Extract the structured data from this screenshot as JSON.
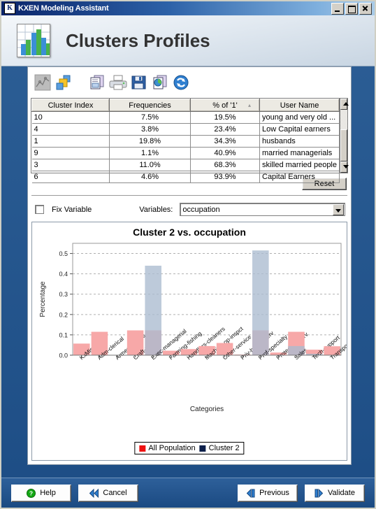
{
  "window": {
    "title": "KXEN Modeling Assistant",
    "icon": "K",
    "controls": [
      {
        "name": "minimize-button",
        "label": "_"
      },
      {
        "name": "maximize-button",
        "label": "□"
      },
      {
        "name": "close-button",
        "label": "×"
      }
    ]
  },
  "banner": {
    "title": "Clusters Profiles",
    "icon": "bar-chart-icon"
  },
  "toolbar": {
    "buttons": [
      {
        "name": "line-chart-icon",
        "enabled": false
      },
      {
        "name": "cluster-squares-icon",
        "enabled": true
      },
      {
        "name": "copy-icon",
        "enabled": true
      },
      {
        "name": "print-icon",
        "enabled": true
      },
      {
        "name": "save-icon",
        "enabled": true
      },
      {
        "name": "export-chart-icon",
        "enabled": true
      },
      {
        "name": "refresh-icon",
        "enabled": true
      }
    ]
  },
  "table": {
    "columns": [
      "Cluster Index",
      "Frequencies",
      "% of '1'",
      "User Name"
    ],
    "sorted_column": "% of '1'",
    "sort_indicator": "▴",
    "rows": [
      {
        "index": "10",
        "frequency": "7.5%",
        "pct1": "19.5%",
        "user_name": "young and very old ..."
      },
      {
        "index": "4",
        "frequency": "3.8%",
        "pct1": "23.4%",
        "user_name": "Low Capital earners"
      },
      {
        "index": "1",
        "frequency": "19.8%",
        "pct1": "34.3%",
        "user_name": "husbands"
      },
      {
        "index": "9",
        "frequency": "1.1%",
        "pct1": "40.9%",
        "user_name": "married managerials"
      },
      {
        "index": "3",
        "frequency": "11.0%",
        "pct1": "68.3%",
        "user_name": "skilled married people"
      },
      {
        "index": "6",
        "frequency": "4.6%",
        "pct1": "93.9%",
        "user_name": "Capital Earners"
      }
    ]
  },
  "controls": {
    "reset_label": "Reset",
    "fix_variable_label": "Fix Variable",
    "fix_variable_checked": false,
    "variables_label": "Variables:",
    "variables_value": "occupation",
    "variables_placeholder": "occupation"
  },
  "chart_data": {
    "type": "bar",
    "title": "Cluster 2 vs. occupation",
    "xlabel": "Categories",
    "ylabel": "Percentage",
    "ylim": [
      0,
      0.55
    ],
    "yticks": [
      "0.0",
      "0.1",
      "0.2",
      "0.3",
      "0.4",
      "0.5"
    ],
    "ytick_values": [
      0,
      0.1,
      0.2,
      0.3,
      0.4,
      0.5
    ],
    "grid": true,
    "legend_position": "bottom",
    "categories": [
      "KxMissing",
      "Adm-clerical",
      "Armed-Forces",
      "Craft-repair",
      "Exec-managerial",
      "Farming-fishing",
      "Handlers-cleaners",
      "Machine-op-inspct",
      "Other-service",
      "Priv-house-serv",
      "Prof-specialty",
      "Protective-serv",
      "Sales",
      "Tech-support",
      "Transport-moving"
    ],
    "series": [
      {
        "name": "All Population",
        "color": "#f7a8a8",
        "legend_color": "#ee1111",
        "values": [
          0.057,
          0.115,
          0.0,
          0.122,
          0.122,
          0.022,
          0.03,
          0.045,
          0.06,
          0.003,
          0.122,
          0.013,
          0.115,
          0.027,
          0.044
        ]
      },
      {
        "name": "Cluster 2",
        "color": "#aabbd0",
        "legend_color": "#0c1f4a",
        "values": [
          0.0,
          0.0,
          0.0,
          0.0,
          0.44,
          0.0,
          0.0,
          0.0,
          0.0,
          0.0,
          0.515,
          0.0,
          0.045,
          0.007,
          0.0
        ]
      }
    ],
    "legend": [
      {
        "label": "All Population",
        "color": "#ee1111"
      },
      {
        "label": "Cluster 2",
        "color": "#0c1f4a"
      }
    ]
  },
  "footer": {
    "buttons": [
      {
        "name": "help-button",
        "label": "Help",
        "icon": "help-icon"
      },
      {
        "name": "cancel-button",
        "label": "Cancel",
        "icon": "double-left-arrow-icon"
      },
      {
        "name": "previous-button",
        "label": "Previous",
        "icon": "previous-arrow-icon"
      },
      {
        "name": "validate-button",
        "label": "Validate",
        "icon": "next-arrow-icon"
      }
    ]
  }
}
